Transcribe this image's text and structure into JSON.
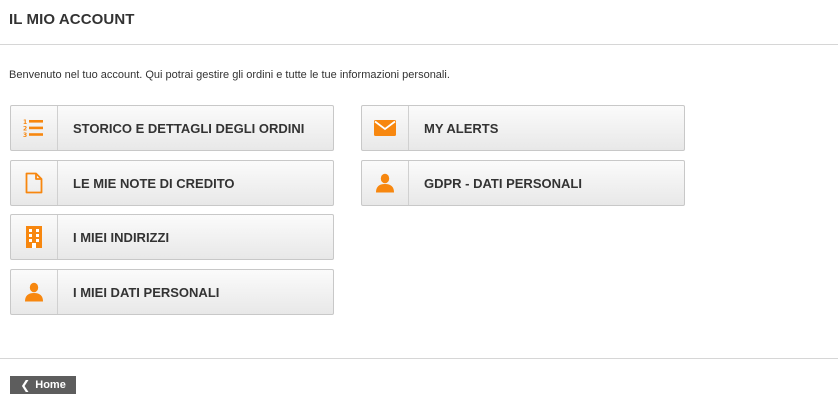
{
  "page": {
    "title": "IL MIO ACCOUNT",
    "welcome": "Benvenuto nel tuo account. Qui potrai gestire gli ordini e tutte le tue informazioni personali."
  },
  "menu": {
    "orders": {
      "label": "STORICO E DETTAGLI DEGLI ORDINI",
      "icon": "list-ordered-icon"
    },
    "credit_notes": {
      "label": "LE MIE NOTE DI CREDITO",
      "icon": "document-icon"
    },
    "addresses": {
      "label": "I MIEI INDIRIZZI",
      "icon": "building-icon"
    },
    "personal_data": {
      "label": "I MIEI DATI PERSONALI",
      "icon": "user-icon"
    },
    "alerts": {
      "label": "MY ALERTS",
      "icon": "envelope-icon"
    },
    "gdpr": {
      "label": "GDPR - DATI PERSONALI",
      "icon": "user-icon"
    }
  },
  "footer": {
    "home_label": "Home",
    "home_icon": "chevron-left-icon"
  },
  "colors": {
    "accent": "#f7870f",
    "text": "#333333",
    "home_bg": "#5d5d5d"
  }
}
